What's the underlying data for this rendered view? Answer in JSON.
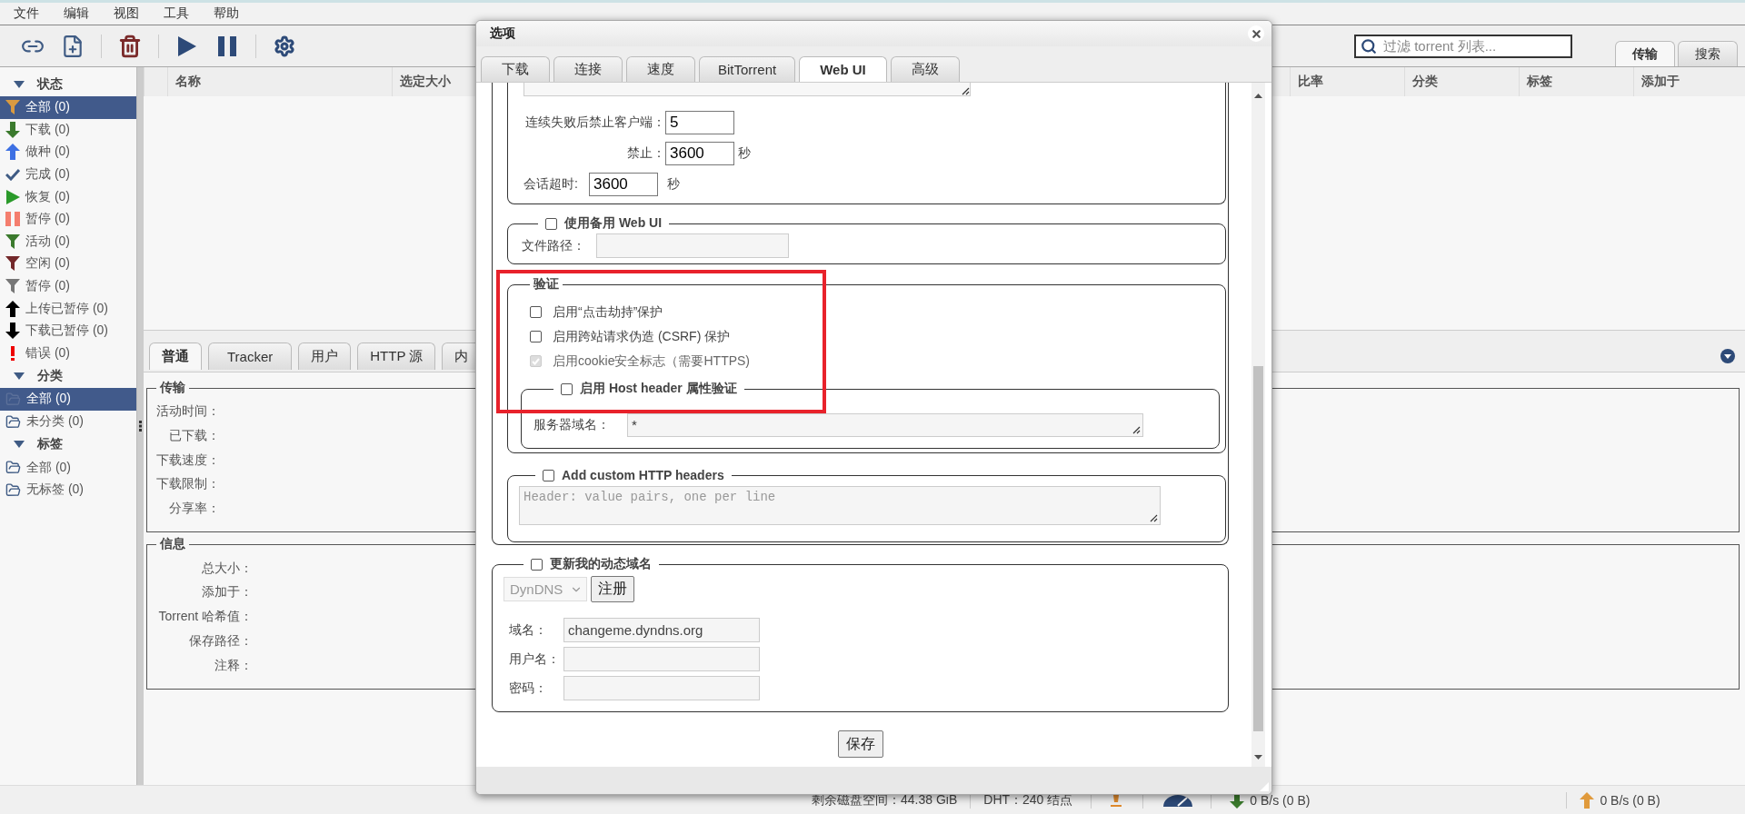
{
  "menu": [
    "文件",
    "编辑",
    "视图",
    "工具",
    "帮助"
  ],
  "toolbar": {
    "search": {
      "placeholder": "过滤 torrent 列表..."
    },
    "tabs": [
      {
        "label": "传输",
        "selected": true
      },
      {
        "label": "搜索",
        "selected": false
      }
    ]
  },
  "sidebar": {
    "sections": [
      {
        "title": "状态",
        "expanded": true,
        "items": [
          {
            "label": "全部 (0)",
            "selected": true
          },
          {
            "label": "下载 (0)",
            "selected": false
          },
          {
            "label": "做种 (0)",
            "selected": false
          },
          {
            "label": "完成 (0)",
            "selected": false
          },
          {
            "label": "恢复 (0)",
            "selected": false
          },
          {
            "label": "暂停 (0)",
            "selected": false
          },
          {
            "label": "活动 (0)",
            "selected": false
          },
          {
            "label": "空闲 (0)",
            "selected": false
          },
          {
            "label": "暂停 (0)",
            "selected": false
          },
          {
            "label": "上传已暂停 (0)",
            "selected": false
          },
          {
            "label": "下载已暂停 (0)",
            "selected": false
          },
          {
            "label": "错误 (0)",
            "selected": false
          }
        ]
      },
      {
        "title": "分类",
        "expanded": true,
        "items": [
          {
            "label": "全部 (0)",
            "selected": true
          },
          {
            "label": "未分类 (0)",
            "selected": false
          }
        ]
      },
      {
        "title": "标签",
        "expanded": true,
        "items": [
          {
            "label": "全部 (0)",
            "selected": false
          },
          {
            "label": "无标签 (0)",
            "selected": false
          }
        ]
      }
    ]
  },
  "table": {
    "columns": [
      "名称",
      "选定大小",
      "比率",
      "分类",
      "标签",
      "添加于"
    ]
  },
  "details": {
    "tabs": [
      {
        "label": "普通",
        "selected": true
      },
      {
        "label": "Tracker",
        "selected": false
      },
      {
        "label": "用户",
        "selected": false
      },
      {
        "label": "HTTP 源",
        "selected": false
      },
      {
        "label": "内",
        "selected": false
      }
    ],
    "groups": [
      {
        "title": "传输",
        "fields": [
          "活动时间：",
          "已下载：",
          "下载速度：",
          "下载限制：",
          "分享率："
        ]
      },
      {
        "title": "信息",
        "fields": [
          "总大小：",
          "添加于：",
          "Torrent 哈希值：",
          "保存路径：",
          "注释："
        ]
      }
    ]
  },
  "dialog": {
    "title": "选项",
    "tabs": [
      {
        "label": "下载",
        "selected": false
      },
      {
        "label": "连接",
        "selected": false
      },
      {
        "label": "速度",
        "selected": false
      },
      {
        "label": "BitTorrent",
        "selected": false
      },
      {
        "label": "Web UI",
        "selected": true
      },
      {
        "label": "高级",
        "selected": false
      }
    ],
    "security": [
      {
        "label": "连续失败后禁止客户端：",
        "value": "5"
      },
      {
        "label": "禁止：",
        "value": "3600",
        "unit": "秒"
      },
      {
        "label": "会话超时:",
        "value": "3600",
        "unit": "秒"
      }
    ],
    "alt_webui": {
      "label": "使用备用 Web UI",
      "checked": false,
      "path_label": "文件路径："
    },
    "auth": {
      "title": "验证",
      "options": [
        {
          "label": "启用“点击劫持”保护",
          "checked": false,
          "disabled": false
        },
        {
          "label": "启用跨站请求伪造 (CSRF) 保护",
          "checked": false,
          "disabled": false
        },
        {
          "label": "启用cookie安全标志（需要HTTPS)",
          "checked": true,
          "disabled": true
        }
      ],
      "host_validation": {
        "label": "启用 Host header 属性验证",
        "checked": false,
        "domains_label": "服务器域名：",
        "domains": "*"
      }
    },
    "custom_headers": {
      "label": "Add custom HTTP headers",
      "checked": false,
      "placeholder": "Header: value pairs, one per line"
    },
    "dyndns": {
      "label": "更新我的动态域名",
      "checked": false,
      "service": "DynDNS",
      "register": "注册",
      "fields": [
        {
          "label": "域名：",
          "value": "changeme.dyndns.org"
        },
        {
          "label": "用户名："
        },
        {
          "label": "密码："
        }
      ]
    },
    "save": "保存"
  },
  "status_bar": {
    "free_space": "剩余磁盘空间：44.38 GiB",
    "dht": "DHT：240 结点",
    "download": "0 B/s (0 B)",
    "upload": "0 B/s (0 B)"
  }
}
